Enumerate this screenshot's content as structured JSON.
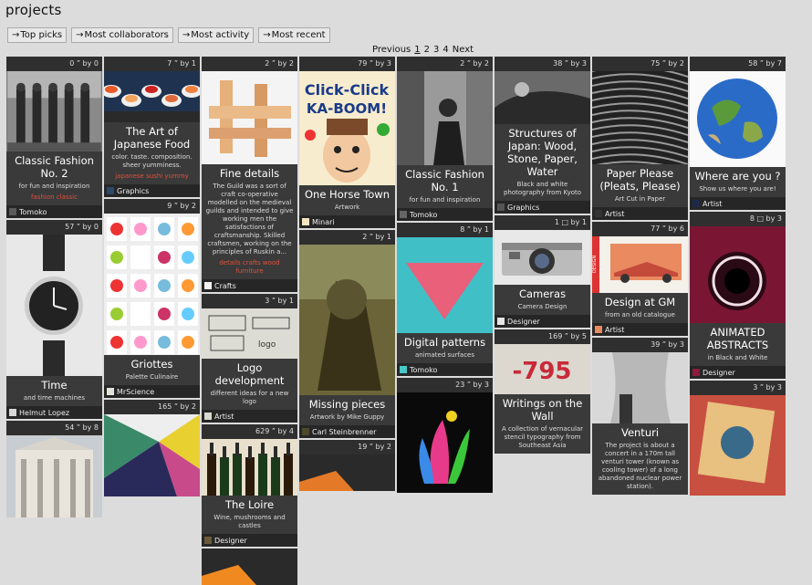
{
  "page": {
    "title": "projects"
  },
  "filters": [
    "Top picks",
    "Most collaborators",
    "Most activity",
    "Most recent"
  ],
  "pagination": {
    "prev": "Previous",
    "pages": [
      "1",
      "2",
      "3",
      "4"
    ],
    "next": "Next"
  },
  "columns": [
    [
      {
        "stats": "0 ” by 0",
        "title": "Classic Fashion No. 2",
        "subtitle": "for fun and inspiration",
        "tags": "fashion classic",
        "user": "Tomoko",
        "icon": "bw-photo-fashion-icon",
        "color": "#5a5a5a",
        "type": "fashion"
      },
      {
        "stats": "57 ” by 0",
        "title": "Time",
        "subtitle": "and time machines",
        "tags": "",
        "user": "Helmut Lopez",
        "icon": "wristwatch-photo",
        "color": "#d8d8d8",
        "type": "watch"
      },
      {
        "stats": "54 ” by 8",
        "title": "",
        "subtitle": "",
        "tags": "",
        "user": "",
        "icon": "building-photo",
        "color": "#9aa0a6",
        "type": "building"
      }
    ],
    [
      {
        "stats": "7 ” by 1",
        "title": "The Art of Japanese Food",
        "subtitle": "color. taste. composition. sheer yumminess.",
        "tags": "japanese sushi yummy",
        "user": "Graphics",
        "icon": "sushi-photo",
        "color": "#2b4a6a",
        "type": "food"
      },
      {
        "stats": "9 ” by 2",
        "title": "Griottes",
        "subtitle": "Palette Culinaire",
        "tags": "",
        "user": "MrScience",
        "icon": "food-grid-photo",
        "color": "#e4e2da",
        "type": "grid"
      },
      {
        "stats": "165 ” by 2",
        "title": "",
        "subtitle": "",
        "tags": "",
        "user": "",
        "icon": "geometric-art",
        "color": "#6a9a3a",
        "type": "geo"
      }
    ],
    [
      {
        "stats": "2 ” by 2",
        "title": "Fine details",
        "subtitle": "The Guild was a sort of craft co-operative modelled on the medieval guilds and intended to give working men the satisfactions of craftsmanship. Skilled craftsmen, working on the principles of Ruskin a...",
        "tags": "details crafts wood furniture",
        "user": "Crafts",
        "icon": "wood-joint-photo",
        "color": "#f2f2f2",
        "type": "wood"
      },
      {
        "stats": "3 ” by 1",
        "title": "Logo development",
        "subtitle": "different ideas for a new logo",
        "tags": "",
        "user": "Artist",
        "icon": "sketch-image",
        "color": "#d8d8d0",
        "type": "sketch"
      },
      {
        "stats": "629 ” by 4",
        "title": "The Loire",
        "subtitle": "Wine, mushrooms and castles",
        "tags": "",
        "user": "Designer",
        "icon": "wine-bottles-photo",
        "color": "#6b5a3a",
        "type": "wine"
      },
      {
        "stats": "",
        "title": "",
        "subtitle": "",
        "tags": "",
        "user": "",
        "icon": "orange-shape",
        "color": "#f08a20",
        "type": "orange"
      }
    ],
    [
      {
        "stats": "79 ” by 3",
        "title": "One Horse Town",
        "subtitle": "Artwork",
        "tags": "",
        "user": "Minari",
        "icon": "comic-illustration",
        "color": "#f4e6c0",
        "type": "comic"
      },
      {
        "stats": "2 ” by 1",
        "title": "Missing pieces",
        "subtitle": "Artwork by Mike Guppy",
        "tags": "",
        "user": "Carl Steinbrenner",
        "icon": "painting-image",
        "color": "#4a4a2a",
        "type": "painting"
      },
      {
        "stats": "19 ” by 2",
        "title": "",
        "subtitle": "",
        "tags": "",
        "user": "",
        "icon": "orange-shape",
        "color": "#e47a28",
        "type": "orange2"
      }
    ],
    [
      {
        "stats": "2 ” by 2",
        "title": "Classic Fashion No. 1",
        "subtitle": "for fun and inspiration",
        "tags": "",
        "user": "Tomoko",
        "icon": "bw-portrait-photo",
        "color": "#666",
        "type": "portrait"
      },
      {
        "stats": "8 ” by 1",
        "title": "Digital patterns",
        "subtitle": "animated surfaces",
        "tags": "",
        "user": "Tomoko",
        "icon": "pink-triangle-art",
        "color": "#48c8c8",
        "type": "triangle"
      },
      {
        "stats": "23 ” by 3",
        "title": "",
        "subtitle": "",
        "tags": "",
        "user": "",
        "icon": "paint-splash",
        "color": "#111",
        "type": "splash"
      }
    ],
    [
      {
        "stats": "38 ” by 3",
        "title": "Structures of Japan: Wood, Stone, Paper, Water",
        "subtitle": "Black and white photography from Kyoto",
        "tags": "",
        "user": "Graphics",
        "icon": "bw-japan-photo",
        "color": "#555",
        "type": "japan"
      },
      {
        "stats": "1 □ by 1",
        "title": "Cameras",
        "subtitle": "Camera Design",
        "tags": "",
        "user": "Designer",
        "icon": "camera-photo",
        "color": "#e6e6e6",
        "type": "camera"
      },
      {
        "stats": "169 ” by 5",
        "title": "Writings on the Wall",
        "subtitle": "A collection of vernacular stencil typography from Southeast Asia",
        "tags": "",
        "user": "",
        "icon": "stencil-photo",
        "color": "#d8d4cc",
        "type": "stencil"
      }
    ],
    [
      {
        "stats": "75 ” by 2",
        "title": "Paper Please (Pleats, Please)",
        "subtitle": "Art Cut in Paper",
        "tags": "",
        "user": "Artist",
        "icon": "paper-art-photo",
        "color": "#333",
        "type": "pleats"
      },
      {
        "stats": "77 ” by 6",
        "title": "Design at GM",
        "subtitle": "from an old catalogue",
        "tags": "",
        "user": "Artist",
        "icon": "gm-design-image",
        "color": "#e98a60",
        "type": "gm"
      },
      {
        "stats": "39 ” by 3",
        "title": "Venturi",
        "subtitle": "The project is about a concert in a 170m tall venturi tower (known as cooling tower) of a long abandoned nuclear power station).",
        "tags": "",
        "user": "",
        "icon": "tower-photo",
        "color": "#cfcfcf",
        "type": "tower"
      }
    ],
    [
      {
        "stats": "58 ” by 7",
        "title": "Where are you ?",
        "subtitle": "Show us where you are!",
        "tags": "",
        "user": "Artist",
        "icon": "globe-image",
        "color": "#1b2a4a",
        "type": "globe"
      },
      {
        "stats": "8 □ by 3",
        "title": "ANIMATED ABSTRACTS",
        "subtitle": "in Black and White",
        "tags": "",
        "user": "Designer",
        "icon": "abstract-ring-image",
        "color": "#8a1b3b",
        "type": "ring"
      },
      {
        "stats": "3 ” by 3",
        "title": "",
        "subtitle": "",
        "tags": "",
        "user": "",
        "icon": "colorful-art",
        "color": "#b84a3a",
        "type": "art"
      }
    ]
  ]
}
